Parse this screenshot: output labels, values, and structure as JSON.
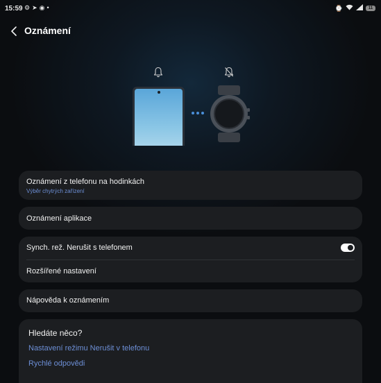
{
  "status_bar": {
    "time": "15:59",
    "left_icons": [
      "settings-cog-icon",
      "telegram-icon",
      "messenger-icon",
      "dot-icon"
    ],
    "right_icons": [
      "wearable-icon",
      "wifi-icon",
      "signal-icon"
    ],
    "battery_level": "11"
  },
  "header": {
    "title": "Oznámení"
  },
  "illustration": {
    "phone_bell_icon": "bell-icon",
    "watch_bell_icon": "bell-off-icon",
    "accent_color": "#4a8fd9"
  },
  "settings": {
    "phone_notifications": {
      "title": "Oznámení z telefonu na hodinkách",
      "subtitle": "Výběr chytrých zařízení"
    },
    "app_notifications": {
      "title": "Oznámení aplikace"
    },
    "sync_dnd": {
      "title": "Synch. rež. Nerušit s telefonem",
      "enabled": true
    },
    "advanced": {
      "title": "Rozšířené nastavení"
    },
    "help": {
      "title": "Nápověda k oznámením"
    }
  },
  "search_section": {
    "title": "Hledáte něco?",
    "links": [
      "Nastavení režimu Nerušit v telefonu",
      "Rychlé odpovědi"
    ]
  },
  "colors": {
    "background": "#0b0d10",
    "card": "#1c1e21",
    "link": "#6d8fd6"
  }
}
